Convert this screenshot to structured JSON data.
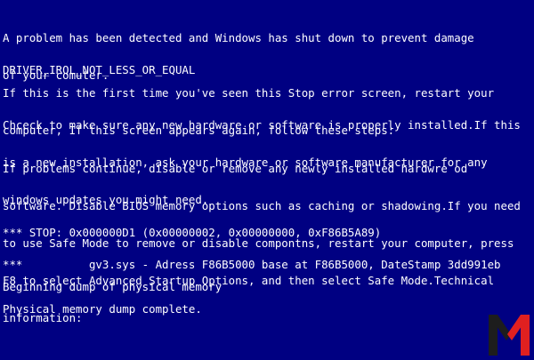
{
  "bsod": {
    "intro": [
      "A problem has been detected and Windows has shut down to prevent damage",
      "of your comuter."
    ],
    "error_code": "DRIVER_IRQL_NOT_LESS_OR_EQUAL",
    "first_time": [
      "If this is the first time you've seen this Stop error screen, restart your",
      "computer, If this screen appears again, follow these steps:"
    ],
    "check": [
      "Chceck to make sure any new hardware or software is properly installed.If this",
      "is a new installation, ask your hardware or software manufacturer for any",
      "windows updates you might need."
    ],
    "problems": [
      "If problems continue, disable or remove any newly installed hardwre od",
      "software. Disable BIOS memory options such as caching or shadowing.If you need",
      "to use Safe Mode to remove or disable compontns, restart your computer, press",
      "F8 to select Advanced Startup Options, and then select Safe Mode.Technical",
      "information:"
    ],
    "stop_line": "*** STOP: 0x000000D1 (0x00000002, 0x00000000, 0xF86B5A89)",
    "driver_line": "***          gv3.sys - Adress F86B5000 base at F86B5000, DateStamp 3dd991eb",
    "dump_start": "Beginning dump of physical memory",
    "dump_done": "Physical memory dump complete."
  },
  "watermark": {
    "letter": "M",
    "colors": {
      "dark": "#1d1d1d",
      "red": "#e02020"
    }
  },
  "colors": {
    "background": "#000082",
    "text": "#ffffff"
  }
}
